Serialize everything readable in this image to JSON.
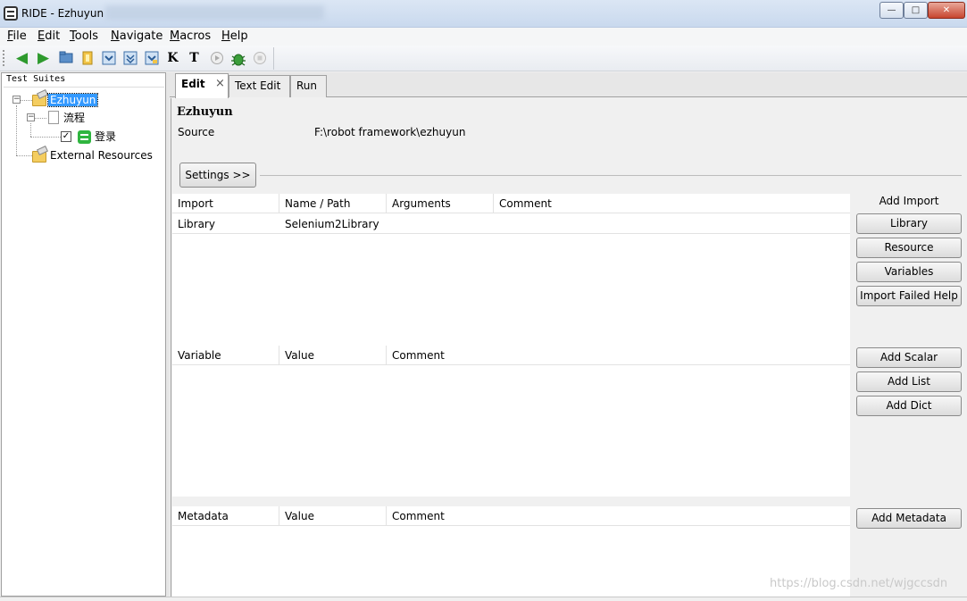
{
  "window": {
    "title": "RIDE - Ezhuyun",
    "minimize": "—",
    "maximize": "□",
    "close": "✕"
  },
  "menu": [
    "File",
    "Edit",
    "Tools",
    "Navigate",
    "Macros",
    "Help"
  ],
  "toolbar": {
    "icons": [
      "back-icon",
      "forward-icon",
      "open-folder-icon",
      "open-directory-icon",
      "save-icon",
      "save-all-icon",
      "save-as-icon",
      "search-keywords-icon",
      "search-tests-icon",
      "run-icon",
      "debug-icon",
      "stop-icon"
    ],
    "k_glyph": "K",
    "t_glyph": "T"
  },
  "tree": {
    "header": "Test Suites",
    "root": "Ezhuyun",
    "suite": "流程",
    "test": "登录",
    "test_checked": "✓",
    "external": "External Resources"
  },
  "tabs": [
    {
      "label": "Edit",
      "close": "×"
    },
    {
      "label": "Text Edit"
    },
    {
      "label": "Run"
    }
  ],
  "editor": {
    "suite_name": "Ezhuyun",
    "source_label": "Source",
    "source_value": "F:\\robot framework\\ezhuyun",
    "settings_button": "Settings >>",
    "imports": {
      "headers": [
        "Import",
        "Name / Path",
        "Arguments",
        "Comment"
      ],
      "rows": [
        [
          "Library",
          "Selenium2Library",
          "",
          ""
        ]
      ]
    },
    "variables": {
      "headers": [
        "Variable",
        "Value",
        "Comment"
      ]
    },
    "metadata": {
      "headers": [
        "Metadata",
        "Value",
        "Comment"
      ]
    },
    "add_import_label": "Add Import",
    "import_buttons": [
      "Library",
      "Resource",
      "Variables",
      "Import Failed Help"
    ],
    "variable_buttons": [
      "Add Scalar",
      "Add List",
      "Add Dict"
    ],
    "metadata_button": "Add Metadata"
  },
  "watermark": "https://blog.csdn.net/wjgccsdn"
}
